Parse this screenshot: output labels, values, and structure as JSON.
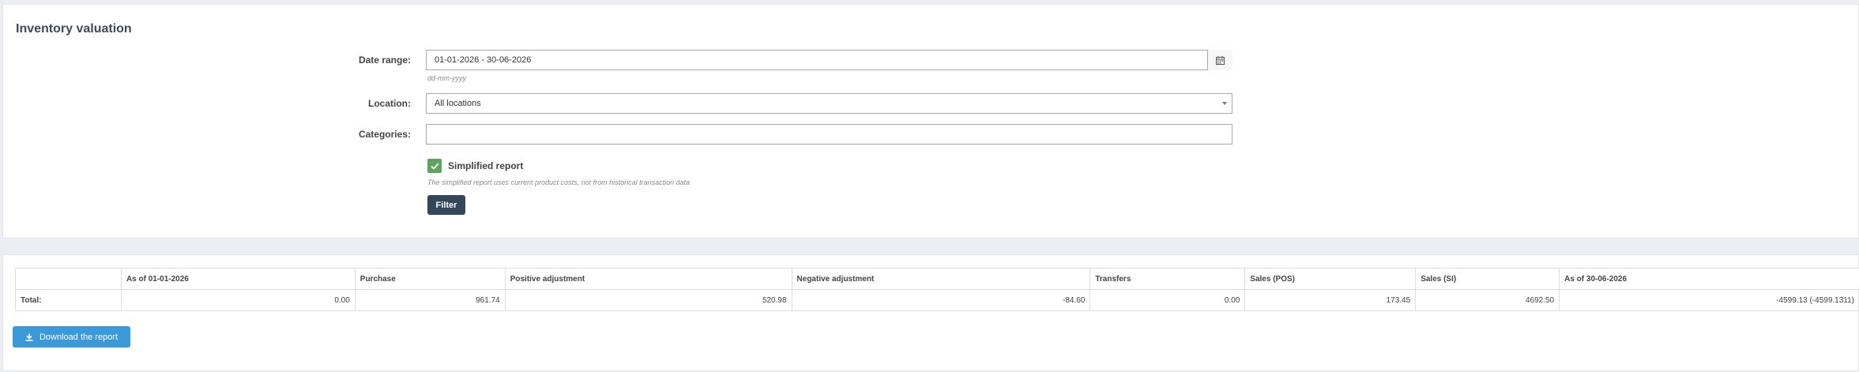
{
  "page": {
    "title": "Inventory valuation"
  },
  "filters": {
    "date_range": {
      "label": "Date range:",
      "value": "01-01-2026 - 30-06-2026",
      "hint": "dd-mm-yyyy"
    },
    "location": {
      "label": "Location:",
      "value": "All locations"
    },
    "categories": {
      "label": "Categories:",
      "value": ""
    },
    "simplified": {
      "label": "Simplified report",
      "checked": true,
      "description": "The simplified report uses current product costs, not from historical transaction data"
    },
    "filter_button": "Filter"
  },
  "report": {
    "columns": [
      "",
      "As of 01-01-2026",
      "Purchase",
      "Positive adjustment",
      "Negative adjustment",
      "Transfers",
      "Sales (POS)",
      "Sales (SI)",
      "As of 30-06-2026"
    ],
    "total_row": {
      "label": "Total:",
      "values": [
        "0.00",
        "961.74",
        "520.98",
        "-84.60",
        "0.00",
        "173.45",
        "4692.50",
        "-4599.13 (-4599.1311)"
      ]
    }
  },
  "download_button": "Download the report",
  "colors": {
    "accent_blue": "#3a9ad9",
    "dark_button": "#34465a",
    "checkbox_green": "#5fa35f"
  },
  "icons": [
    "calendar-icon",
    "chevron-down-icon",
    "check-icon",
    "download-icon"
  ]
}
